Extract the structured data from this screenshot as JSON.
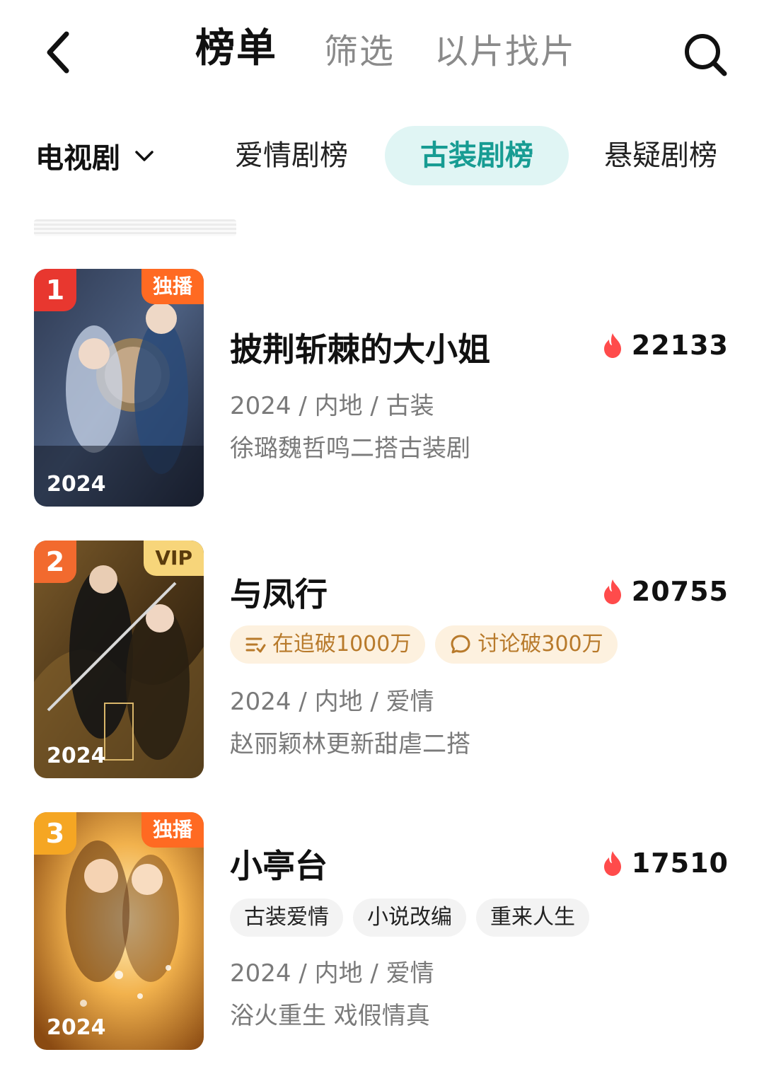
{
  "header": {
    "tabs": [
      {
        "label": "榜单",
        "active": true
      },
      {
        "label": "筛选",
        "active": false
      },
      {
        "label": "以片找片",
        "active": false
      }
    ],
    "back_icon": "chevron-left-icon",
    "search_icon": "search-icon"
  },
  "filters": {
    "category": "电视剧",
    "category_icon": "chevron-down-icon",
    "sub_tabs": [
      {
        "label": "爱情剧榜",
        "active": false
      },
      {
        "label": "古装剧榜",
        "active": true
      },
      {
        "label": "悬疑剧榜",
        "active": false
      }
    ],
    "accent_color": "#179c93"
  },
  "items": [
    {
      "rank": "1",
      "badge": "独播",
      "poster_year": "2024",
      "title": "披荆斩棘的大小姐",
      "heat": "22133",
      "meta": "2024 / 内地 / 古装",
      "desc": "徐璐魏哲鸣二搭古装剧",
      "tags": []
    },
    {
      "rank": "2",
      "badge": "VIP",
      "poster_year": "2024",
      "title": "与凤行",
      "heat": "20755",
      "meta": "2024 / 内地 / 爱情",
      "desc": "赵丽颖林更新甜虐二搭",
      "tags": [
        {
          "label": "在追破1000万",
          "icon": "list-icon"
        },
        {
          "label": "讨论破300万",
          "icon": "comment-icon"
        }
      ]
    },
    {
      "rank": "3",
      "badge": "独播",
      "poster_year": "2024",
      "title": "小亭台",
      "heat": "17510",
      "meta": "2024 / 内地 / 爱情",
      "desc": "浴火重生 戏假情真",
      "tags": [
        {
          "label": "古装爱情"
        },
        {
          "label": "小说改编"
        },
        {
          "label": "重来人生"
        }
      ]
    }
  ],
  "colors": {
    "rank1": "#e8372f",
    "rank2": "#f26a2e",
    "rank3": "#f5a623",
    "flame": "#ff4b4b"
  }
}
